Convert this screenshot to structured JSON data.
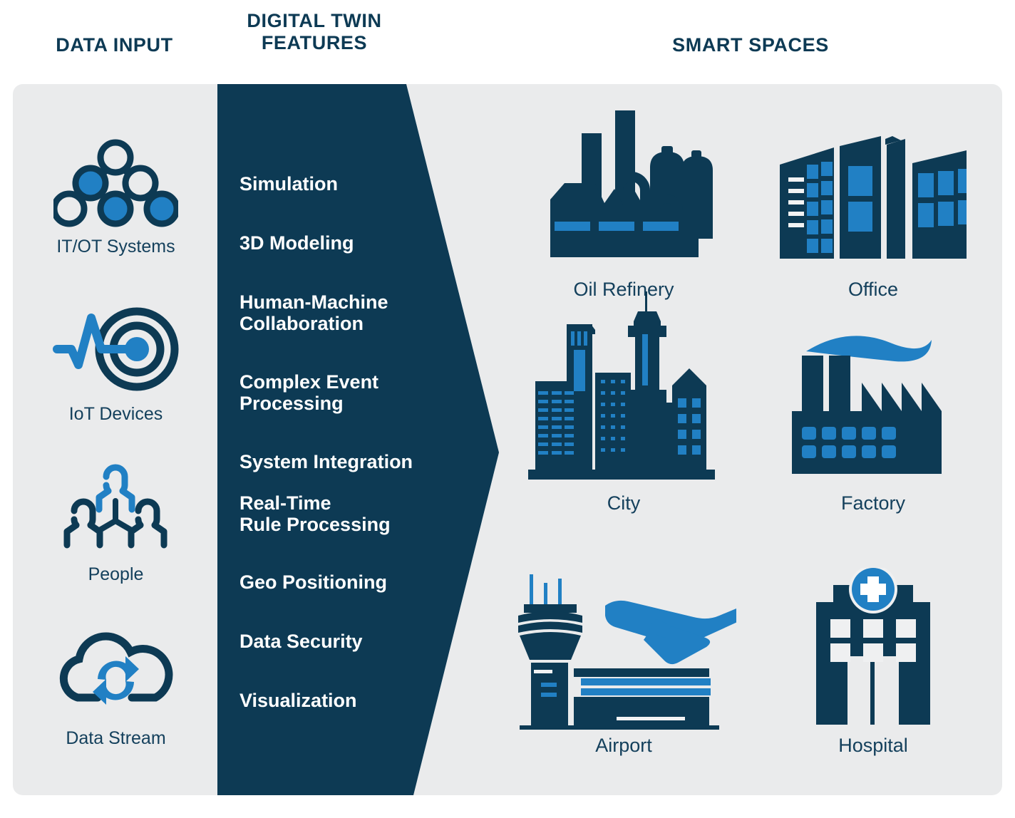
{
  "colors": {
    "dark_navy": "#0d3a54",
    "accent_blue": "#2180c4",
    "panel_gray": "#eaebec",
    "white": "#ffffff"
  },
  "headers": {
    "data_input": "DATA INPUT",
    "digital_twin_features": "DIGITAL TWIN\nFEATURES",
    "smart_spaces": "SMART SPACES"
  },
  "data_input": {
    "items": [
      {
        "label": "IT/OT Systems",
        "icon": "network-nodes-icon"
      },
      {
        "label": "IoT Devices",
        "icon": "pulse-target-icon"
      },
      {
        "label": "People",
        "icon": "people-group-icon"
      },
      {
        "label": "Data Stream",
        "icon": "cloud-sync-icon"
      }
    ]
  },
  "features": {
    "items": [
      "Simulation",
      "3D Modeling",
      "Human-Machine\nCollaboration",
      "Complex Event\nProcessing",
      "System Integration",
      "Real-Time\nRule Processing",
      "Geo Positioning",
      "Data Security",
      "Visualization"
    ]
  },
  "smart_spaces": {
    "items": [
      {
        "label": "Oil Refinery",
        "icon": "oil-refinery-icon"
      },
      {
        "label": "Office",
        "icon": "office-building-icon"
      },
      {
        "label": "City",
        "icon": "city-skyline-icon"
      },
      {
        "label": "Factory",
        "icon": "factory-icon"
      },
      {
        "label": "Airport",
        "icon": "airport-icon"
      },
      {
        "label": "Hospital",
        "icon": "hospital-icon"
      }
    ]
  }
}
